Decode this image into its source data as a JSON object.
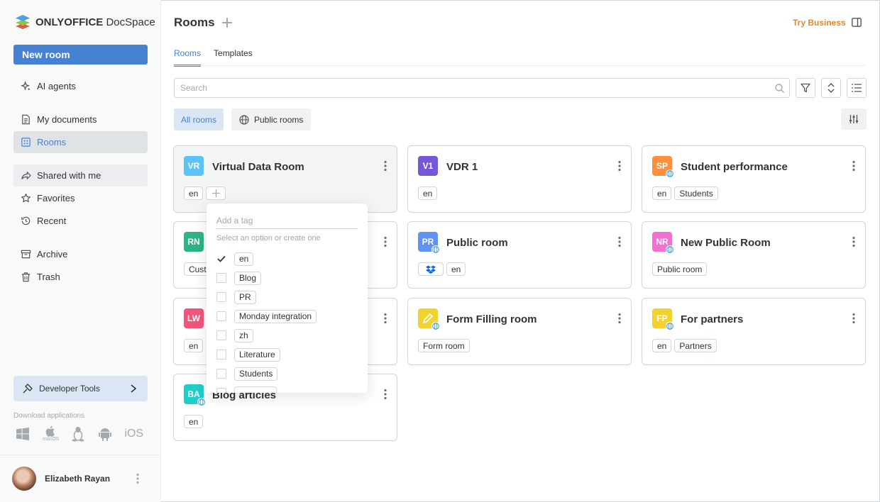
{
  "app": {
    "logo_bold": "ONLYOFFICE",
    "logo_light": "DocSpace",
    "new_room_label": "New room"
  },
  "sidebar": {
    "items": [
      {
        "label": "AI agents",
        "icon": "sparkle-icon"
      },
      {
        "label": "My documents",
        "icon": "document-icon"
      },
      {
        "label": "Rooms",
        "icon": "rooms-grid-icon",
        "active": true
      },
      {
        "label": "Shared with me",
        "icon": "share-icon"
      },
      {
        "label": "Favorites",
        "icon": "star-icon"
      },
      {
        "label": "Recent",
        "icon": "recent-icon"
      },
      {
        "label": "Archive",
        "icon": "archive-icon"
      },
      {
        "label": "Trash",
        "icon": "trash-icon"
      }
    ],
    "developer_tools": "Developer Tools",
    "download_label": "Download applications",
    "apps": [
      "windows-icon",
      "macos-icon",
      "linux-icon",
      "android-icon",
      "ios-icon"
    ],
    "macos_label": "macOS",
    "ios_label": "iOS",
    "user": {
      "name": "Elizabeth Rayan"
    }
  },
  "header": {
    "title": "Rooms",
    "try_business": "Try Business",
    "tabs": [
      {
        "label": "Rooms",
        "active": true
      },
      {
        "label": "Templates",
        "active": false
      }
    ]
  },
  "search": {
    "placeholder": "Search"
  },
  "filters": [
    {
      "label": "All rooms",
      "active": true
    },
    {
      "label": "Public rooms",
      "active": false
    }
  ],
  "colors": {
    "accent": "#4781d1",
    "try_business": "#e0892e",
    "vr": "#5cc3f7",
    "v1": "#7757d9",
    "sp": "#ff8e3d",
    "rn": "#2db482",
    "pr": "#6191f2",
    "nr": "#f270d1",
    "lw": "#f2557c",
    "ff": "#f2d230",
    "fp": "#f2d230",
    "ba": "#1fcecb"
  },
  "rooms": [
    {
      "logo": "VR",
      "title": "Virtual Data Room",
      "tags": [
        "en"
      ]
    },
    {
      "logo": "V1",
      "title": "VDR 1",
      "tags": [
        "en"
      ]
    },
    {
      "logo": "SP",
      "title": "Student performance",
      "tags": [
        "en",
        "Students"
      ]
    },
    {
      "logo": "RN",
      "title": "",
      "tags": [
        "Cust"
      ]
    },
    {
      "logo": "PR",
      "title": "Public room",
      "tags": [
        "en"
      ]
    },
    {
      "logo": "NR",
      "title": "New Public Room",
      "tags": [
        "Public room"
      ]
    },
    {
      "logo": "LW",
      "title": "",
      "tags": [
        "en"
      ]
    },
    {
      "logo": "",
      "title": "Form Filling room",
      "tags": [
        "Form room"
      ]
    },
    {
      "logo": "FP",
      "title": "For partners",
      "tags": [
        "en",
        "Partners"
      ]
    },
    {
      "logo": "BA",
      "title": "Blog articles",
      "tags": [
        "en"
      ]
    }
  ],
  "tag_dropdown": {
    "placeholder": "Add a tag",
    "hint": "Select an option or create one",
    "options": [
      {
        "label": "en",
        "checked": true
      },
      {
        "label": "Blog",
        "checked": false
      },
      {
        "label": "PR",
        "checked": false
      },
      {
        "label": "Monday integration",
        "checked": false
      },
      {
        "label": "zh",
        "checked": false
      },
      {
        "label": "Literature",
        "checked": false
      },
      {
        "label": "Students",
        "checked": false
      }
    ]
  }
}
